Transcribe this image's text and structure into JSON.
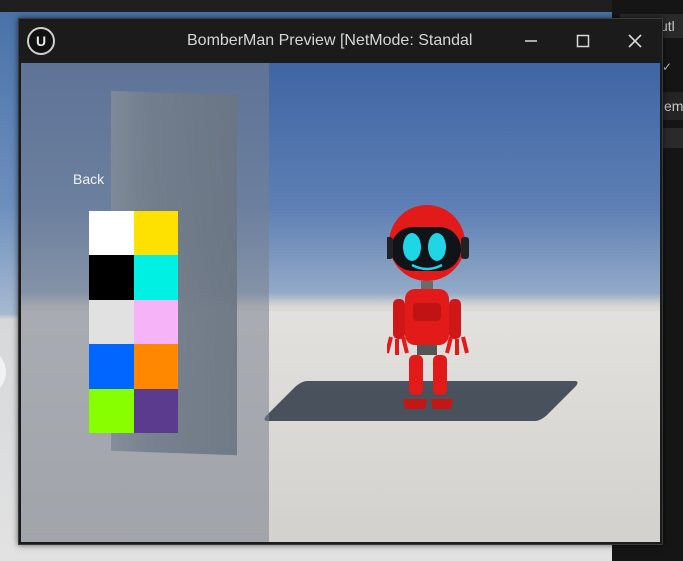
{
  "window": {
    "title": "BomberMan Preview [NetMode: Standal",
    "logo_text": "U",
    "minimize_label": "—",
    "maximize_label": "☐",
    "close_label": "✕"
  },
  "menu": {
    "back_label": "Back"
  },
  "color_swatches": [
    {
      "name": "white",
      "color": "#ffffff"
    },
    {
      "name": "yellow",
      "color": "#ffe100"
    },
    {
      "name": "black",
      "color": "#000000"
    },
    {
      "name": "cyan",
      "color": "#00f1e4"
    },
    {
      "name": "light-gray",
      "color": "#e1e1e1"
    },
    {
      "name": "pink",
      "color": "#f7b3f7"
    },
    {
      "name": "blue",
      "color": "#0066ff"
    },
    {
      "name": "orange",
      "color": "#ff8800"
    },
    {
      "name": "lime",
      "color": "#88ff00"
    },
    {
      "name": "purple",
      "color": "#5a3b8e"
    }
  ],
  "background_editor": {
    "tab_label": "utl",
    "row_label": "em"
  },
  "colors": {
    "robot_red": "#e21a1a",
    "robot_visor": "#101418",
    "robot_eyes": "#1fd6e6"
  }
}
